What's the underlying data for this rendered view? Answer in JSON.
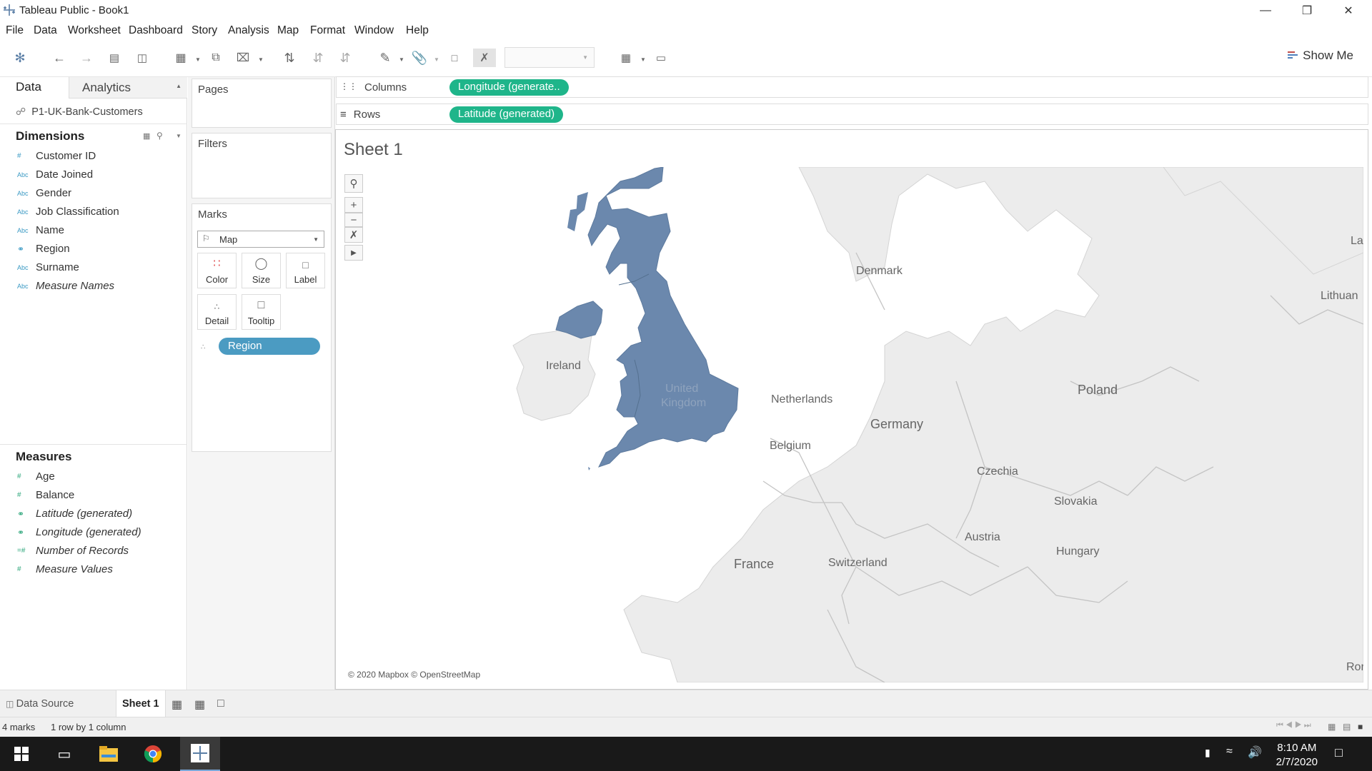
{
  "window": {
    "title": "Tableau Public - Book1"
  },
  "menu": [
    "File",
    "Data",
    "Worksheet",
    "Dashboard",
    "Story",
    "Analysis",
    "Map",
    "Format",
    "Window",
    "Help"
  ],
  "toolbar": {
    "show_me": "Show Me"
  },
  "data_pane": {
    "tab_data": "Data",
    "tab_analytics": "Analytics",
    "datasource": "P1-UK-Bank-Customers",
    "dimensions_title": "Dimensions",
    "dimensions": [
      {
        "name": "Customer ID",
        "type": "#"
      },
      {
        "name": "Date Joined",
        "type": "Abc"
      },
      {
        "name": "Gender",
        "type": "Abc"
      },
      {
        "name": "Job Classification",
        "type": "Abc"
      },
      {
        "name": "Name",
        "type": "Abc"
      },
      {
        "name": "Region",
        "type": "geo"
      },
      {
        "name": "Surname",
        "type": "Abc"
      },
      {
        "name": "Measure Names",
        "type": "Abc"
      }
    ],
    "measures_title": "Measures",
    "measures": [
      {
        "name": "Age",
        "type": "#"
      },
      {
        "name": "Balance",
        "type": "#"
      },
      {
        "name": "Latitude (generated)",
        "type": "geo"
      },
      {
        "name": "Longitude (generated)",
        "type": "geo"
      },
      {
        "name": "Number of Records",
        "type": "#"
      },
      {
        "name": "Measure Values",
        "type": "#"
      }
    ]
  },
  "cards": {
    "pages": "Pages",
    "filters": "Filters",
    "marks": "Marks",
    "mark_type": "Map",
    "buttons": [
      "Color",
      "Size",
      "Label",
      "Detail",
      "Tooltip"
    ],
    "region_pill": "Region"
  },
  "shelves": {
    "columns_label": "Columns",
    "columns_pill": "Longitude (generate..",
    "rows_label": "Rows",
    "rows_pill": "Latitude (generated)"
  },
  "sheet": {
    "title": "Sheet 1",
    "map_labels": [
      "Denmark",
      "Lithuan",
      "Ireland",
      "United",
      "Kingdom",
      "Netherlands",
      "Poland",
      "Germany",
      "Belgium",
      "Czechia",
      "Slovakia",
      "Austria",
      "Hungary",
      "France",
      "Switzerland",
      "La",
      "Ror"
    ],
    "attribution": "© 2020 Mapbox © OpenStreetMap"
  },
  "bottom_tabs": {
    "data_source": "Data Source",
    "sheet1": "Sheet 1"
  },
  "status": {
    "marks": "4 marks",
    "dims": "1 row by 1 column"
  },
  "taskbar": {
    "time": "8:10 AM",
    "date": "2/7/2020"
  },
  "colors": {
    "accent_pill": "#1fb58a",
    "region_pill": "#4b9bc2",
    "uk_fill": "#6b88ad",
    "land": "#ececec"
  }
}
